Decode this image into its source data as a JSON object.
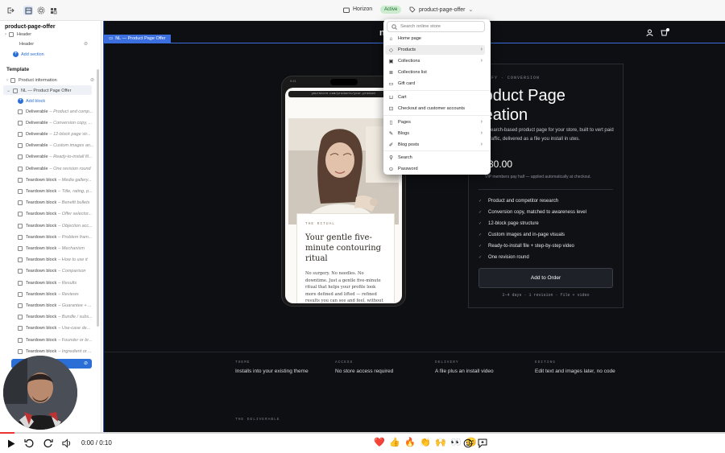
{
  "topbar": {
    "theme_name": "Horizon",
    "theme_status": "Active",
    "page_selector": "product-page-offer"
  },
  "sidebar": {
    "title": "product-page-offer",
    "header_group": "Header",
    "header_item": "Header",
    "add_section": "Add section",
    "template_label": "Template",
    "product_information": "Product information",
    "selected_section": "NL — Product Page Offer",
    "add_block": "Add block",
    "blocks": [
      {
        "name": "Deliverable",
        "note": "– Product and comp..."
      },
      {
        "name": "Deliverable",
        "note": "– Conversion copy, ..."
      },
      {
        "name": "Deliverable",
        "note": "– 12-block page str..."
      },
      {
        "name": "Deliverable",
        "note": "– Custom images an..."
      },
      {
        "name": "Deliverable",
        "note": "– Ready-to-install fil..."
      },
      {
        "name": "Deliverable",
        "note": "– One revision round"
      },
      {
        "name": "Teardown block",
        "note": "– Media gallery..."
      },
      {
        "name": "Teardown block",
        "note": "– Title, rating, p..."
      },
      {
        "name": "Teardown block",
        "note": "– Benefit bullets"
      },
      {
        "name": "Teardown block",
        "note": "– Offer selector..."
      },
      {
        "name": "Teardown block",
        "note": "– Objection acc..."
      },
      {
        "name": "Teardown block",
        "note": "– Problem fram..."
      },
      {
        "name": "Teardown block",
        "note": "– Mechanism"
      },
      {
        "name": "Teardown block",
        "note": "– How to use it"
      },
      {
        "name": "Teardown block",
        "note": "– Comparison"
      },
      {
        "name": "Teardown block",
        "note": "– Results"
      },
      {
        "name": "Teardown block",
        "note": "– Reviews"
      },
      {
        "name": "Teardown block",
        "note": "– Guarantee + ..."
      },
      {
        "name": "Teardown block",
        "note": "– Bundle / subs..."
      },
      {
        "name": "Teardown block",
        "note": "– Use-case de..."
      },
      {
        "name": "Teardown block",
        "note": "– Founder or br..."
      },
      {
        "name": "Teardown block",
        "note": "– Ingredient or ..."
      }
    ]
  },
  "canvas": {
    "section_label": "NL — Product Page Offer",
    "store_name": "n",
    "phone": {
      "url": "yourstore.com/products/your-product",
      "kicker": "THE RITUAL",
      "title": "Your gentle five-minute contouring ritual",
      "body": "No surgery. No needles. No downtime. Just a gentle five-minute ritual that helps your profile look more defined and lifted — refined results you can see and feel, without any of the risk"
    },
    "panel": {
      "kicker": "OFY · CONVERSION",
      "title_line1": "roduct Page",
      "title_line2": "reation",
      "description": "search-based product page for your store, built to vert paid traffic, delivered as a file you install in utes.",
      "price": "30.00",
      "note": "VIP members pay half — applied automatically at checkout.",
      "features": [
        "Product and competitor research",
        "Conversion copy, matched to awareness level",
        "12-block page structure",
        "Custom images and in-page visuals",
        "Ready-to-install file + step-by-step video",
        "One revision round"
      ],
      "button": "Add to Order",
      "meta": "2–4 days · 1 revision · file + video"
    },
    "strip": [
      {
        "key": "THEME",
        "value": "Installs into your existing theme"
      },
      {
        "key": "ACCESS",
        "value": "No store access required"
      },
      {
        "key": "DELIVERY",
        "value": "A file plus an install video"
      },
      {
        "key": "EDITING",
        "value": "Edit text and images later, no code"
      }
    ],
    "deliverable_label": "THE DELIVERABLE"
  },
  "dropdown": {
    "search_placeholder": "Search online store",
    "items": [
      {
        "label": "Home page",
        "icon": "home-icon",
        "chevron": false
      },
      {
        "label": "Products",
        "icon": "tag-icon",
        "chevron": true
      },
      {
        "label": "Collections",
        "icon": "collection-icon",
        "chevron": true
      },
      {
        "label": "Collections list",
        "icon": "list-icon",
        "chevron": false
      },
      {
        "label": "Gift card",
        "icon": "gift-card-icon",
        "chevron": false
      },
      {
        "label": "Cart",
        "icon": "cart-icon",
        "chevron": false
      },
      {
        "label": "Checkout and customer accounts",
        "icon": "checkout-icon",
        "chevron": false
      },
      {
        "label": "Pages",
        "icon": "page-icon",
        "chevron": true
      },
      {
        "label": "Blogs",
        "icon": "blog-icon",
        "chevron": true
      },
      {
        "label": "Blog posts",
        "icon": "blog-post-icon",
        "chevron": true
      },
      {
        "label": "Search",
        "icon": "search-icon",
        "chevron": false
      },
      {
        "label": "Password",
        "icon": "lock-icon",
        "chevron": false
      }
    ]
  },
  "player": {
    "time": "0:00 / 0:10",
    "progress": 0.02,
    "emojis": [
      "❤️",
      "👍",
      "🔥",
      "👏",
      "🙌",
      "👀",
      "😊"
    ]
  },
  "colors": {
    "accent_blue": "#3b6fe0",
    "canvas_bg": "#0d0f12",
    "badge_green": "#cdeccf"
  }
}
